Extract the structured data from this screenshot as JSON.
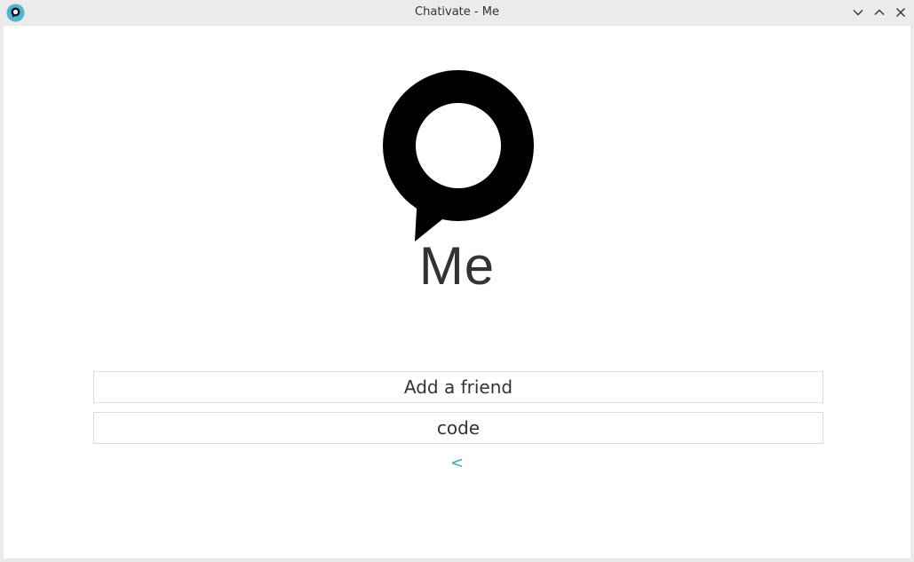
{
  "window": {
    "title": "Chativate - Me",
    "accent": "#3aa7c4"
  },
  "titlebar_buttons": {
    "minimize_icon": "chevron-down-icon",
    "maximize_icon": "chevron-up-icon",
    "close_icon": "close-icon"
  },
  "page": {
    "heading": "Me",
    "add_friend_label": "Add a friend",
    "code_label": "code",
    "back_label": "<"
  }
}
